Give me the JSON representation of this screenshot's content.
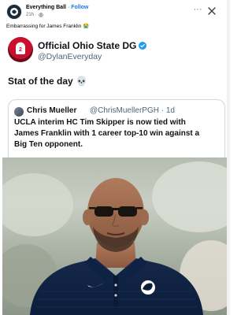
{
  "post": {
    "page_name": "Everything Ball",
    "separator": "·",
    "follow_label": "Follow",
    "time": "21h ·",
    "caption": "Embarrassing for James Franklin 😭"
  },
  "tweet": {
    "display_name": "Official Ohio State DG",
    "handle": "@DylanEveryday",
    "avatar_number": "2",
    "text": "Stat of the day 💀",
    "quote": {
      "name": "Chris Mueller",
      "handle": "@ChrisMuellerPGH · 1d",
      "lines": [
        "UCLA interim HC Tim Skipper is now tied with",
        "James Franklin with 1 career top-10 win against a",
        "Big Ten opponent."
      ]
    }
  },
  "colors": {
    "accent": "#1877f2",
    "verified": "#1d9bf0",
    "polo": "#0b1d3a",
    "background": "#ffffff"
  },
  "icons": [
    "page-logo-icon",
    "globe-icon",
    "more-icon",
    "close-icon",
    "verified-icon",
    "penn-state-logo-icon",
    "sunglasses"
  ]
}
